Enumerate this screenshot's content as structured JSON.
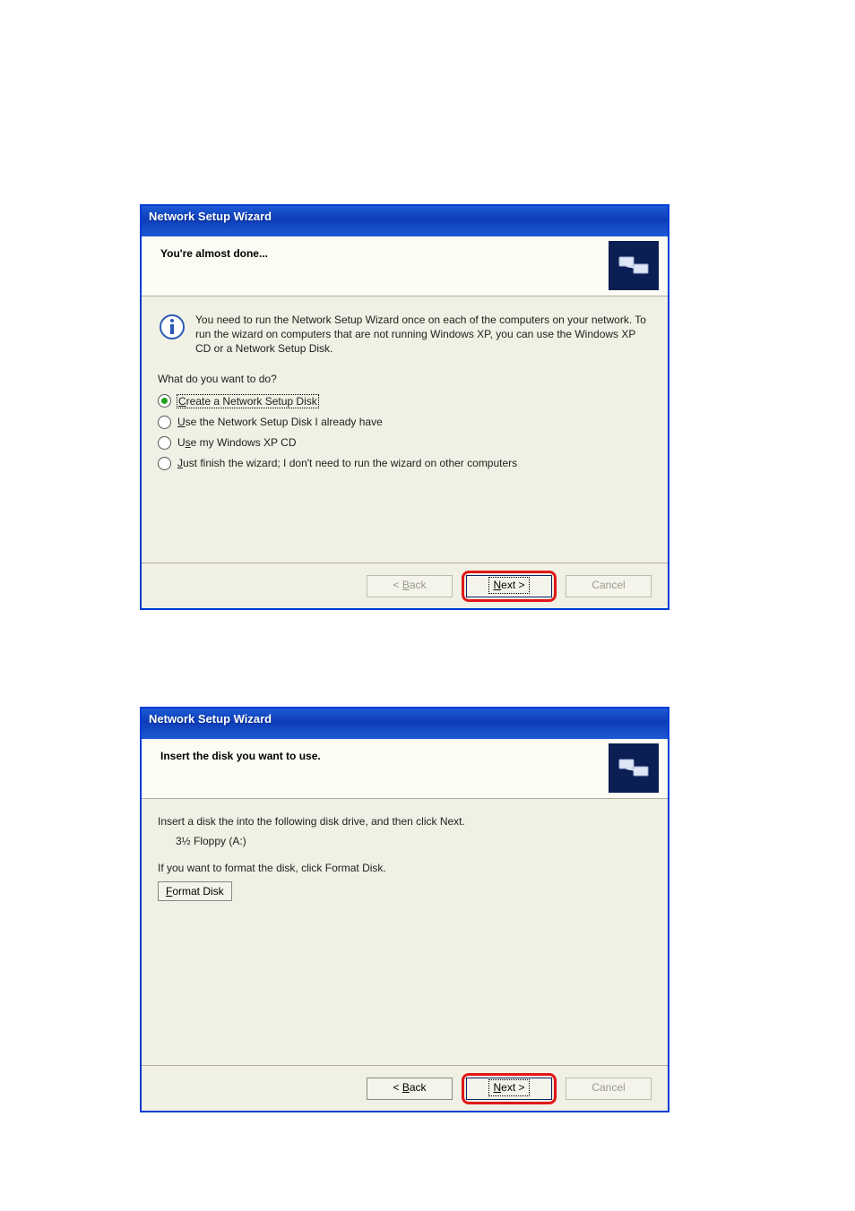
{
  "dialog1": {
    "title": "Network Setup Wizard",
    "heading": "You're almost done...",
    "info_text": "You need to run the Network Setup Wizard once on each of the computers on your network. To run the wizard on computers that are not running Windows XP, you can use the Windows XP CD or a Network Setup Disk.",
    "question": "What do you want to do?",
    "options": [
      {
        "accel": "C",
        "rest": "reate a Network Setup Disk",
        "selected": true
      },
      {
        "accel": "U",
        "rest": "se the Network Setup Disk I already have",
        "selected": false
      },
      {
        "accel": "s",
        "pre": "U",
        "rest": "e my Windows XP CD",
        "selected": false
      },
      {
        "accel": "J",
        "rest": "ust finish the wizard; I don't need to run the wizard on other computers",
        "selected": false
      }
    ],
    "buttons": {
      "back_pre": "< ",
      "back_accel": "B",
      "back_rest": "ack",
      "next_accel": "N",
      "next_rest": "ext >",
      "cancel": "Cancel"
    }
  },
  "dialog2": {
    "title": "Network Setup Wizard",
    "heading": "Insert the disk you want to use.",
    "line1": "Insert a disk the into the following disk drive, and then click Next.",
    "drive": "3½ Floppy (A:)",
    "line2": "If you want to format the disk, click Format Disk.",
    "format_btn_accel": "F",
    "format_btn_rest": "ormat Disk",
    "buttons": {
      "back_pre": "< ",
      "back_accel": "B",
      "back_rest": "ack",
      "next_accel": "N",
      "next_rest": "ext >",
      "cancel": "Cancel"
    }
  }
}
